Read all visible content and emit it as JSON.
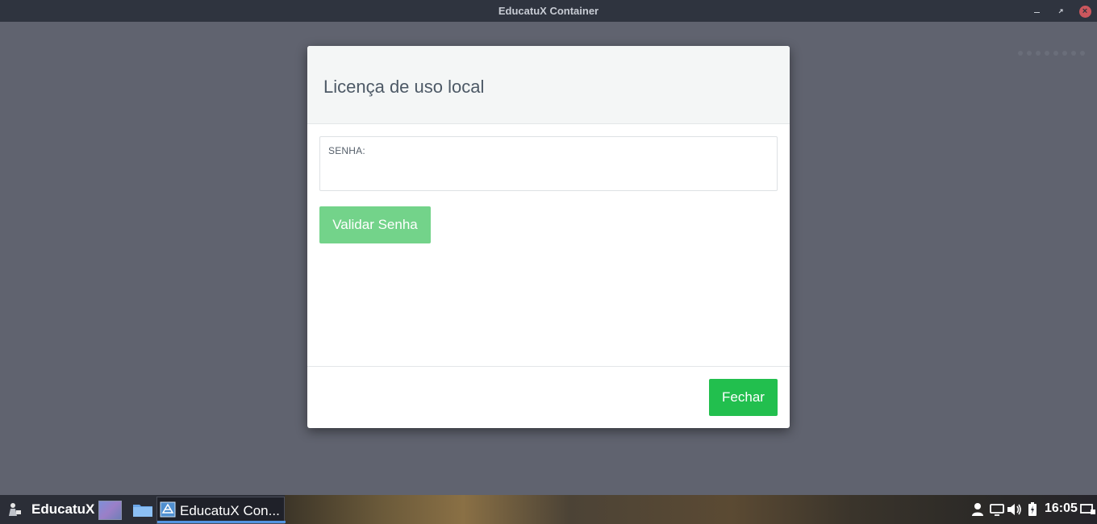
{
  "window": {
    "title": "EducatuX Container",
    "controls": {
      "minimize_icon": "minimize-icon",
      "maximize_icon": "maximize-icon",
      "close_icon": "close-icon",
      "close_symbol": "×"
    }
  },
  "modal": {
    "title": "Licença de uso local",
    "password_field": {
      "label": "SENHA:",
      "value": "",
      "placeholder": ""
    },
    "validate_button": "Validar Senha",
    "close_button": "Fechar"
  },
  "taskbar": {
    "brand": "EducatuX",
    "active_task": "EducatuX Con...",
    "clock": "16:05",
    "tray_icons": [
      "user-icon",
      "network-icon",
      "volume-icon",
      "battery-icon",
      "show-desktop-icon"
    ]
  },
  "colors": {
    "titlebar": "#2f343f",
    "workspace": "#60636f",
    "validate_button": "#73d38a",
    "close_button": "#22bf4e",
    "taskbar": "#2b2e37",
    "taskbar_accent": "#5294e2",
    "window_close": "#cc575d"
  }
}
